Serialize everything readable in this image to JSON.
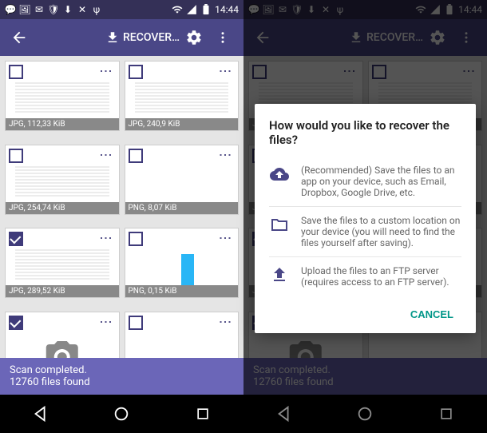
{
  "status": {
    "time": "14:44"
  },
  "toolbar": {
    "recover_label": "RECOVER…"
  },
  "tiles": [
    {
      "label": "JPG, 112,33 KiB",
      "selected": false,
      "type": "doc"
    },
    {
      "label": "JPG, 240,9 KiB",
      "selected": false,
      "type": "doc"
    },
    {
      "label": "JPG, 254,74 KiB",
      "selected": false,
      "type": "doc"
    },
    {
      "label": "PNG, 8,07 KiB",
      "selected": false,
      "type": "checker"
    },
    {
      "label": "JPG, 289,52 KiB",
      "selected": true,
      "type": "doc"
    },
    {
      "label": "PNG, 0,15 KiB",
      "selected": false,
      "type": "checker-bar"
    },
    {
      "label": "",
      "selected": true,
      "type": "camera"
    },
    {
      "label": "",
      "selected": false,
      "type": "checker"
    }
  ],
  "footer": {
    "line1": "Scan completed.",
    "line2": "12760 files found"
  },
  "dialog": {
    "title": "How would you like to recover the files?",
    "opt1": "(Recommended) Save the files to an app on your device, such as Email, Dropbox, Google Drive, etc.",
    "opt2": "Save the files to a custom location on your device (you will need to find the files yourself after saving).",
    "opt3": "Upload the files to an FTP server (requires access to an FTP server).",
    "cancel": "CANCEL"
  }
}
